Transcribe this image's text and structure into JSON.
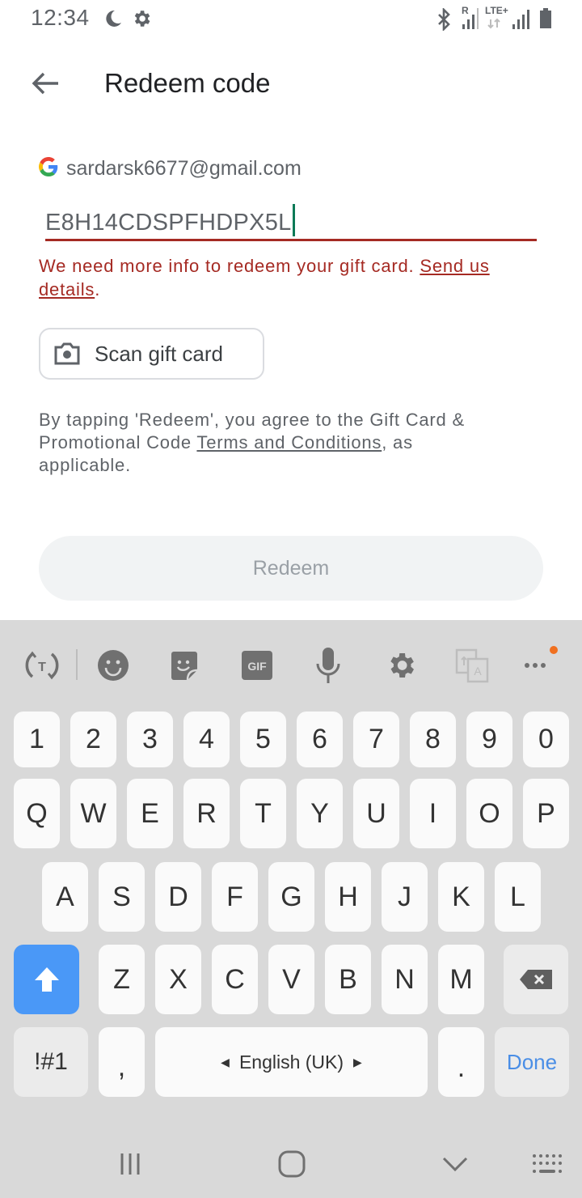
{
  "status_bar": {
    "time": "12:34",
    "left_icons": [
      "night-mode-icon",
      "settings-icon"
    ],
    "right_icons": [
      "bluetooth-icon",
      "roaming-signal-icon",
      "lte-plus-data-icon",
      "signal-icon",
      "battery-icon"
    ],
    "roaming_label": "R",
    "network_label": "LTE+"
  },
  "app_bar": {
    "back_icon": "arrow-back-icon",
    "title": "Redeem code"
  },
  "account": {
    "icon": "google-g-icon",
    "email": "sardarsk6677@gmail.com"
  },
  "code_field": {
    "value": "E8H14CDSPFHDPX5L"
  },
  "error": {
    "message": "We need more info to redeem your gift card. ",
    "link": "Send us details",
    "suffix": "."
  },
  "scan_button": {
    "icon": "camera-icon",
    "label": "Scan gift card"
  },
  "terms": {
    "prefix": "By tapping 'Redeem', you agree to the Gift Card & Promotional Code ",
    "link": "Terms and Conditions",
    "suffix": ", as applicable."
  },
  "redeem_button": {
    "label": "Redeem",
    "enabled": false
  },
  "keyboard": {
    "toolbar": [
      "text-correction-icon",
      "emoji-icon",
      "sticker-icon",
      "gif-icon",
      "microphone-icon",
      "settings-icon",
      "translate-icon",
      "more-icon"
    ],
    "gif_label": "GIF",
    "rows": {
      "numbers": [
        "1",
        "2",
        "3",
        "4",
        "5",
        "6",
        "7",
        "8",
        "9",
        "0"
      ],
      "top": [
        "Q",
        "W",
        "E",
        "R",
        "T",
        "Y",
        "U",
        "I",
        "O",
        "P"
      ],
      "middle": [
        "A",
        "S",
        "D",
        "F",
        "G",
        "H",
        "J",
        "K",
        "L"
      ],
      "bottom": [
        "Z",
        "X",
        "C",
        "V",
        "B",
        "N",
        "M"
      ]
    },
    "symbols_key": "!#1",
    "comma_key": ",",
    "space_label": "English (UK)",
    "period_key": ".",
    "done_key": "Done"
  },
  "nav_bar": [
    "recents-icon",
    "home-icon",
    "hide-keyboard-icon",
    "keyboard-switch-icon"
  ],
  "colors": {
    "error": "#a52a23",
    "caret": "#0b7a57",
    "shift_active": "#4a98f7",
    "done": "#4a8ee6",
    "notification_dot": "#f07020"
  }
}
